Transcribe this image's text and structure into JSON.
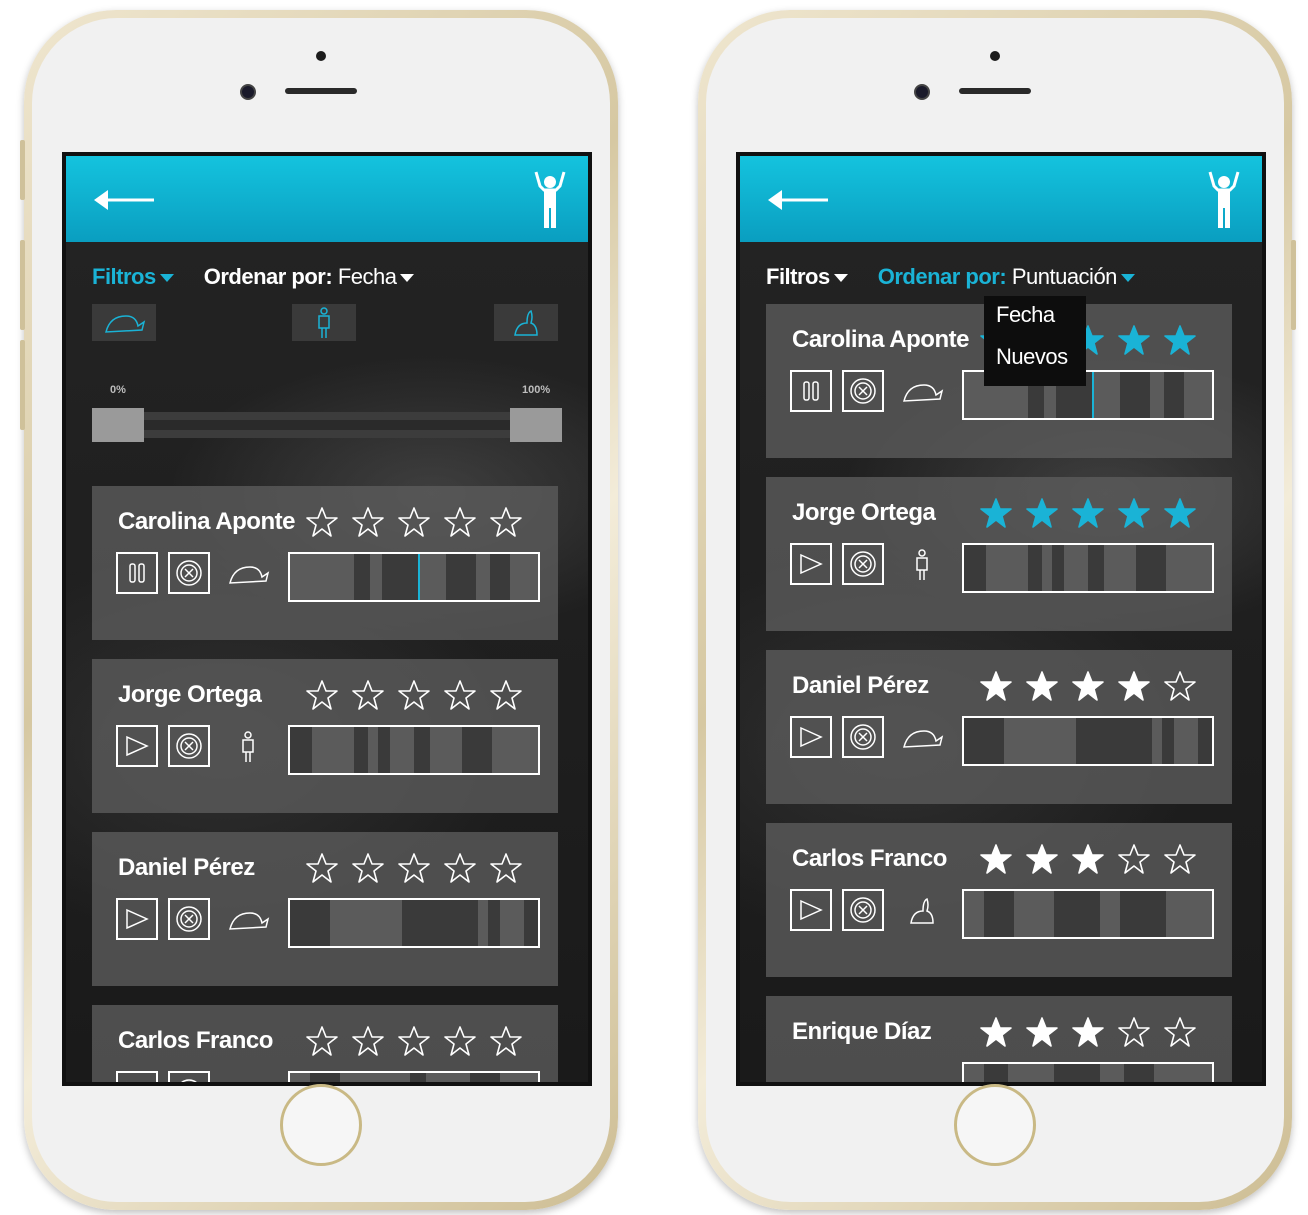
{
  "colors": {
    "accent": "#1ab3d6",
    "header": "#0fb0d3",
    "star_active": "#1ab3d6",
    "star_white": "#ffffff"
  },
  "left_phone": {
    "toolbar": {
      "filters_label": "Filtros",
      "sort_label": "Ordenar por:",
      "sort_value": "Fecha"
    },
    "slider": {
      "min_label": "0%",
      "max_label": "100%",
      "min_value": 0,
      "max_value": 100
    },
    "filter_icons": [
      "turtle-icon",
      "person-icon",
      "rabbit-icon"
    ],
    "cards": [
      {
        "name": "Carolina Aponte",
        "rating": 0,
        "state": "pause",
        "speed_icon": "turtle-icon"
      },
      {
        "name": "Jorge Ortega",
        "rating": 0,
        "state": "play",
        "speed_icon": "person-icon"
      },
      {
        "name": "Daniel Pérez",
        "rating": 0,
        "state": "play",
        "speed_icon": "turtle-icon"
      },
      {
        "name": "Carlos Franco",
        "rating": 0,
        "state": "play",
        "speed_icon": "rabbit-icon"
      }
    ]
  },
  "right_phone": {
    "toolbar": {
      "filters_label": "Filtros",
      "sort_label": "Ordenar por:",
      "sort_value": "Puntuación"
    },
    "dropdown": {
      "options": [
        "Fecha",
        "Nuevos"
      ]
    },
    "cards": [
      {
        "name": "Carolina Aponte",
        "rating": 5,
        "star_color": "blue",
        "state": "pause",
        "speed_icon": "turtle-icon"
      },
      {
        "name": "Jorge Ortega",
        "rating": 5,
        "star_color": "blue",
        "state": "play",
        "speed_icon": "person-icon"
      },
      {
        "name": "Daniel Pérez",
        "rating": 4,
        "star_color": "white",
        "state": "play",
        "speed_icon": "turtle-icon"
      },
      {
        "name": "Carlos Franco",
        "rating": 3,
        "star_color": "white",
        "state": "play",
        "speed_icon": "rabbit-icon"
      },
      {
        "name": "Enrique Díaz",
        "rating": 3,
        "star_color": "white",
        "state": "play",
        "speed_icon": "person-icon"
      }
    ]
  }
}
